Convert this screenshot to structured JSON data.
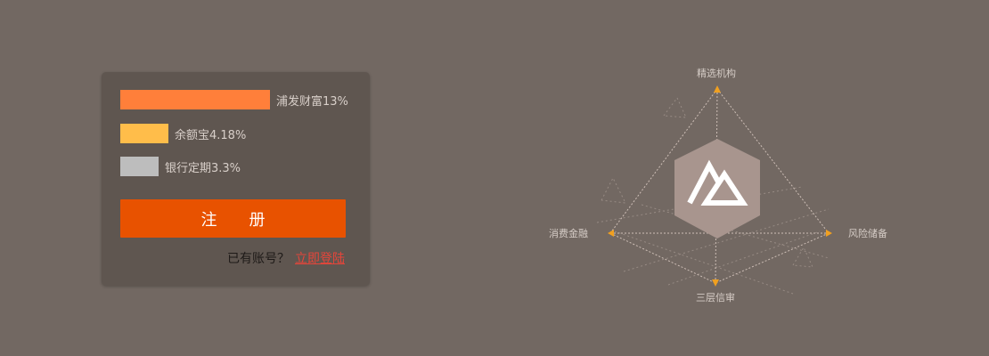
{
  "rates": [
    {
      "label": "浦发财富13%",
      "color": "#ff7f3a",
      "level": 13
    },
    {
      "label": "余额宝4.18%",
      "color": "#ffbd4a",
      "level": 4.18
    },
    {
      "label": "银行定期3.3%",
      "color": "#bdbdbd",
      "level": 3.3
    }
  ],
  "register": {
    "label": "注册"
  },
  "login": {
    "prompt": "已有账号？",
    "link": "立即登陆"
  },
  "diagram": {
    "top_label": "精选机构",
    "left_label": "消费金融",
    "right_label": "风险储备",
    "bottom_label": "三层信审",
    "accent_color": "#f0a020",
    "badge_color": "#a8958e"
  }
}
